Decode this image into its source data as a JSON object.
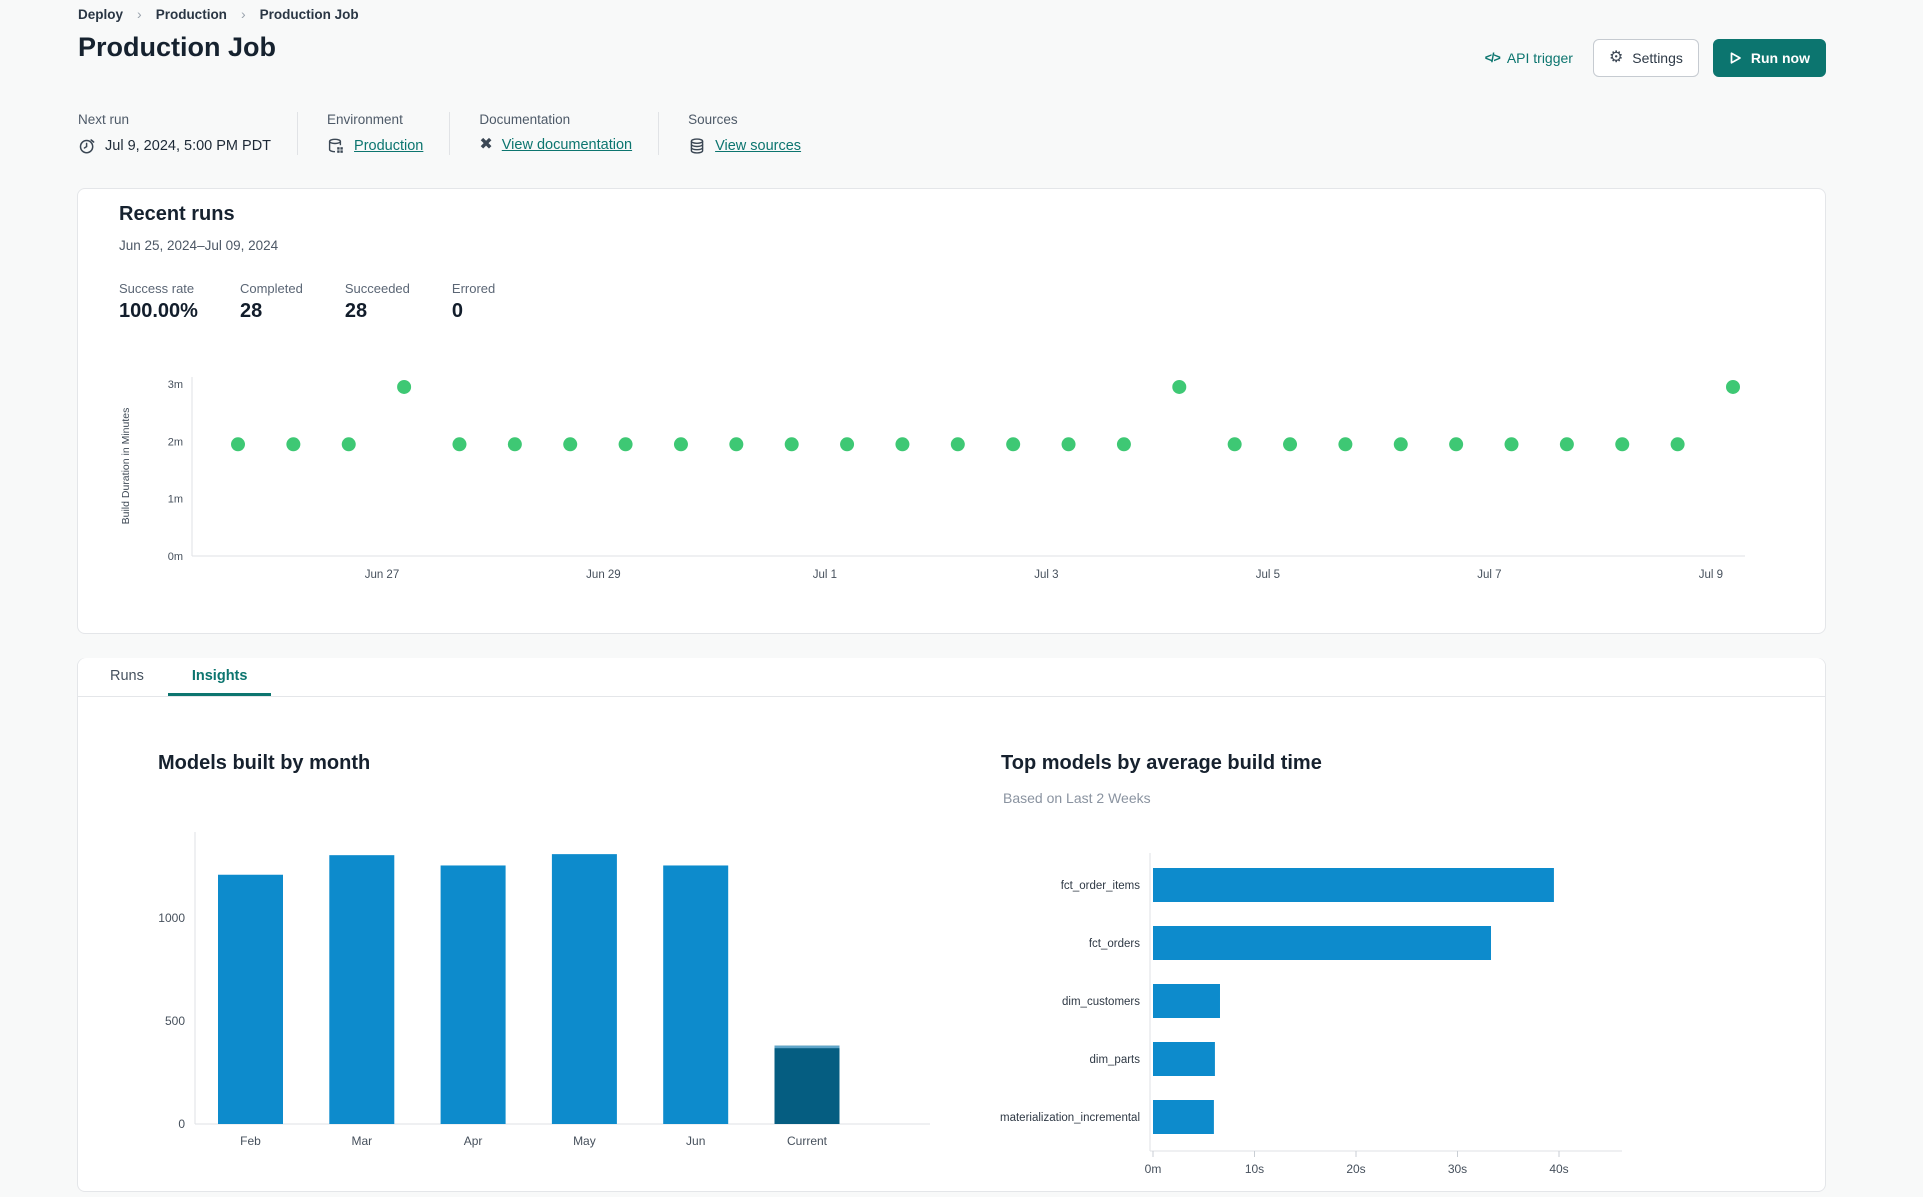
{
  "breadcrumb": {
    "items": [
      "Deploy",
      "Production",
      "Production Job"
    ],
    "separator": "›"
  },
  "header": {
    "title": "Production Job",
    "api_trigger_label": "API trigger",
    "api_trigger_icon": "</>",
    "settings_label": "Settings",
    "run_now_label": "Run now"
  },
  "info": {
    "next_run": {
      "label": "Next run",
      "value": "Jul 9, 2024, 5:00 PM PDT",
      "icon": "alarm-clock-icon"
    },
    "environment": {
      "label": "Environment",
      "value": "Production",
      "icon": "environment-database-icon"
    },
    "documentation": {
      "label": "Documentation",
      "value": "View documentation",
      "icon": "dbt-logo-icon"
    },
    "sources": {
      "label": "Sources",
      "value": "View sources",
      "icon": "sources-database-icon"
    }
  },
  "recent_runs": {
    "title": "Recent runs",
    "date_range": "Jun 25, 2024–Jul 09, 2024",
    "stats": [
      {
        "label": "Success rate",
        "value": "100.00%"
      },
      {
        "label": "Completed",
        "value": "28"
      },
      {
        "label": "Succeeded",
        "value": "28"
      },
      {
        "label": "Errored",
        "value": "0"
      }
    ]
  },
  "tabs": [
    {
      "label": "Runs",
      "active": false
    },
    {
      "label": "Insights",
      "active": true
    }
  ],
  "colors": {
    "accent_teal": "#0c756f",
    "run_dot_green": "#3ec874",
    "bar_blue": "#0d8bcc",
    "bar_dark_blue": "#055d81",
    "card_border": "#e4e6e9",
    "axis_gray": "#dfe2e5"
  },
  "chart_data": [
    {
      "id": "run-durations",
      "type": "scatter",
      "title": "",
      "ylabel": "Build Duration in Minutes",
      "yticks": [
        "0m",
        "1m",
        "2m",
        "3m"
      ],
      "ylim_minutes": [
        0,
        3.2
      ],
      "xtick_labels": [
        "Jun 27",
        "Jun 29",
        "Jul 1",
        "Jul 3",
        "Jul 5",
        "Jul 7",
        "Jul 9"
      ],
      "xtick_positions": [
        2.6,
        6.6,
        10.6,
        14.6,
        18.6,
        22.6,
        26.6
      ],
      "points_minutes": [
        1.95,
        1.95,
        1.95,
        2.95,
        1.95,
        1.95,
        1.95,
        1.95,
        1.95,
        1.95,
        1.95,
        1.95,
        1.95,
        1.95,
        1.95,
        1.95,
        1.95,
        2.95,
        1.95,
        1.95,
        1.95,
        1.95,
        1.95,
        1.95,
        1.95,
        1.95,
        1.95,
        2.95
      ],
      "point_color": "#3ec874",
      "axis_color": "#dfe2e5",
      "grid": false
    },
    {
      "id": "models-built-by-month",
      "type": "bar",
      "title": "Models built by month",
      "categories": [
        "Feb",
        "Mar",
        "Apr",
        "May",
        "Jun",
        "Current"
      ],
      "values": [
        1210,
        1305,
        1255,
        1310,
        1255,
        380
      ],
      "yticks": [
        0,
        500,
        1000
      ],
      "ylim": [
        0,
        1420
      ],
      "bar_color": "#0d8bcc",
      "current_bar_color": "#055d81",
      "grid": false
    },
    {
      "id": "top-models-by-avg-build-time",
      "type": "bar-horizontal",
      "title": "Top models by average build time",
      "subtitle": "Based on Last 2 Weeks",
      "categories": [
        "fct_order_items",
        "fct_orders",
        "dim_customers",
        "dim_parts",
        "materialization_incremental"
      ],
      "values_seconds": [
        39.5,
        33.3,
        6.6,
        6.1,
        6.0
      ],
      "xticks": [
        "0m",
        "10s",
        "20s",
        "30s",
        "40s"
      ],
      "xlim_seconds": [
        0,
        44
      ],
      "bar_color": "#0d8bcc",
      "grid": false
    }
  ]
}
